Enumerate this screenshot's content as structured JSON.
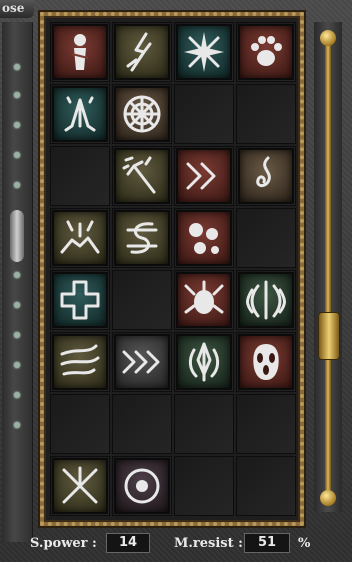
{
  "window": {
    "close_label": "ose"
  },
  "stats": {
    "spell_power_label": "S.power :",
    "spell_power_value": "14",
    "magic_resist_label": "M.resist :",
    "magic_resist_value": "51",
    "magic_resist_unit": "%"
  },
  "skills": [
    {
      "name": "totem-skill-icon",
      "tone": "red"
    },
    {
      "name": "lightning-skill-icon",
      "tone": "olive"
    },
    {
      "name": "star-burst-skill-icon",
      "tone": "teal"
    },
    {
      "name": "paw-skill-icon",
      "tone": "red"
    },
    {
      "name": "praying-hands-skill-icon",
      "tone": "teal"
    },
    {
      "name": "web-skill-icon",
      "tone": "brown"
    },
    null,
    null,
    null,
    {
      "name": "strike-skill-icon",
      "tone": "olive"
    },
    {
      "name": "double-arrow-skill-icon",
      "tone": "red"
    },
    {
      "name": "flame-swirl-skill-icon",
      "tone": "brown"
    },
    {
      "name": "eruption-skill-icon",
      "tone": "olive"
    },
    {
      "name": "serpent-skill-icon",
      "tone": "olive"
    },
    {
      "name": "boulders-skill-icon",
      "tone": "red"
    },
    null,
    {
      "name": "holy-cross-skill-icon",
      "tone": "teal"
    },
    null,
    {
      "name": "beetle-skill-icon",
      "tone": "red"
    },
    {
      "name": "tribal-shield-skill-icon",
      "tone": "green"
    },
    {
      "name": "wind-swirl-skill-icon",
      "tone": "olive"
    },
    {
      "name": "triple-arrow-skill-icon",
      "tone": "gray"
    },
    {
      "name": "tribal-blade-skill-icon",
      "tone": "green"
    },
    {
      "name": "ghost-mask-skill-icon",
      "tone": "red"
    },
    null,
    null,
    null,
    null,
    {
      "name": "scatter-skill-icon",
      "tone": "olive"
    },
    {
      "name": "ring-skill-icon",
      "tone": "purple"
    },
    null,
    null
  ]
}
